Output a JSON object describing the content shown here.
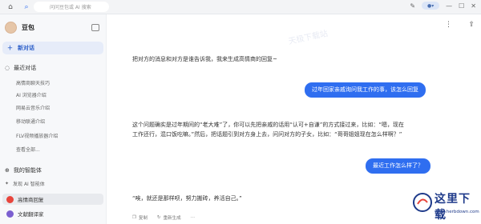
{
  "topbar": {
    "search_placeholder": "问问豆包或 AI 搜索"
  },
  "sidebar": {
    "brand_name": "豆包",
    "new_chat_label": "新对话",
    "recent_title": "最近对话",
    "recent_items": [
      "高情商聊天技巧",
      "AI 浏览器介绍",
      "网易云音乐介绍",
      "移动联通介绍",
      "FLV视频播放器介绍",
      "查看全部..."
    ],
    "agents_title": "我的智能体",
    "discover_label": "发现 AI 智能体",
    "agents": [
      {
        "label": "高情商回复",
        "color": "#e8453c"
      },
      {
        "label": "文献翻译家",
        "color": "#7b5fd0"
      }
    ]
  },
  "chat": {
    "watermark": "天极下载站",
    "messages": [
      {
        "role": "bot",
        "text": "把对方的消息和对方是谁告诉我，我来生成高情商的回复~"
      },
      {
        "role": "user",
        "text": "过年回家亲戚询问我工作的事，该怎么回复"
      },
      {
        "role": "bot",
        "lines": [
          "这个问题确实是过年期间的“老大难”了，你可以先把亲戚的话用“认可+自谦”的方式接过来，比如：“嗯，现在",
          "工作还行，混口饭吃嘛。”然后，把话题引到对方身上去，问问对方的子女，比如：“哥哥姐姐现在怎么样啊？”"
        ]
      },
      {
        "role": "user",
        "text": "最近工作怎么样了？"
      },
      {
        "role": "bot",
        "text": "“唉，就还是那样呗，努力搬砖，养活自己。”"
      }
    ],
    "actions": [
      "复制",
      "重新生成"
    ]
  },
  "overlay": {
    "logo_text": "这里下载",
    "logo_url": "www.herbdown.com"
  }
}
